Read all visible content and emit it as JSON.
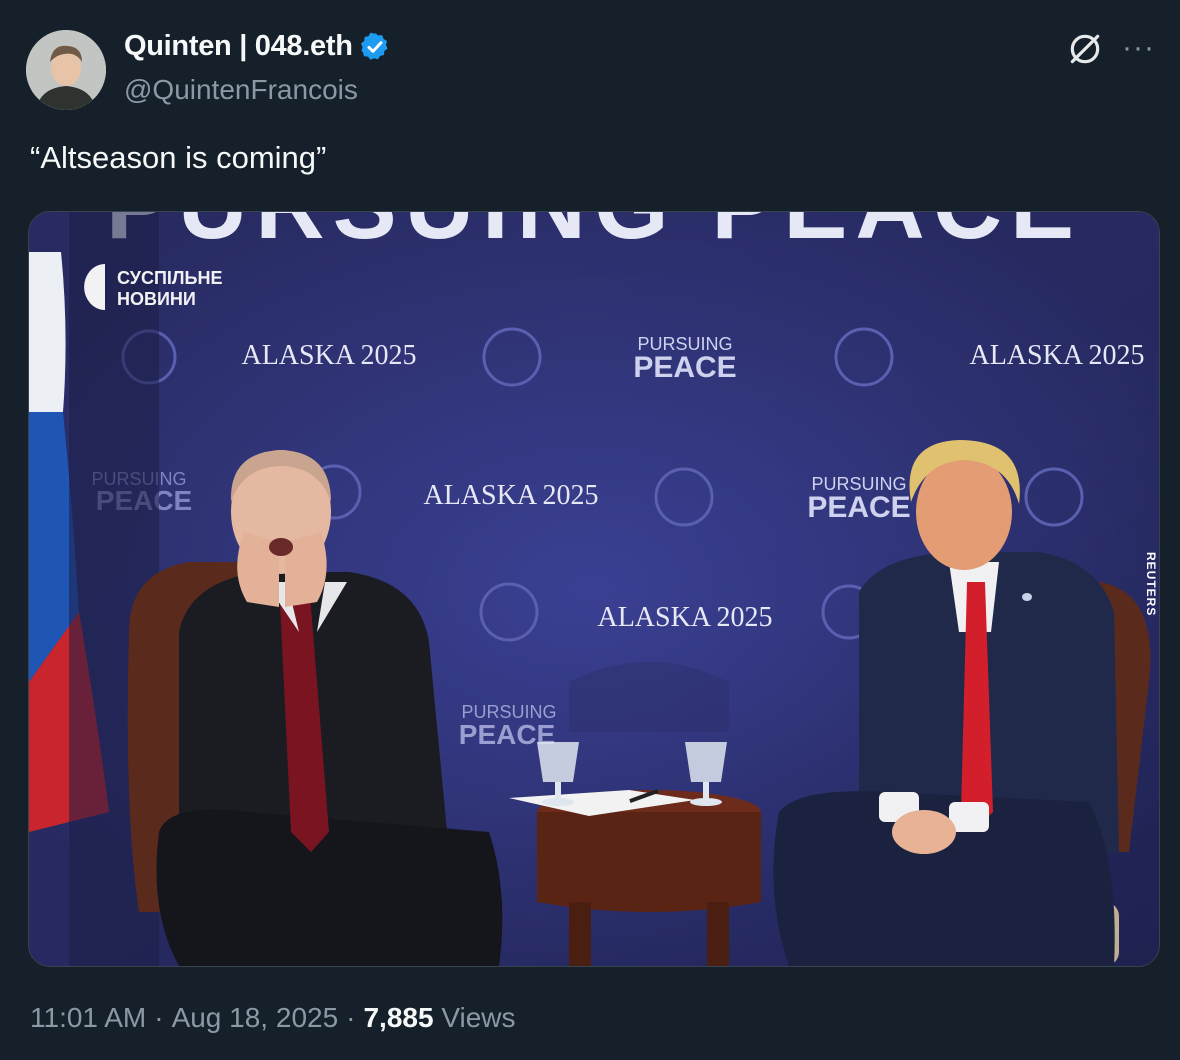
{
  "author": {
    "display_name": "Quinten | 048.eth",
    "handle": "@QuintenFrancois",
    "verified_icon": "verified-badge-icon"
  },
  "header_icons": {
    "grok": "grok-icon",
    "more": "···"
  },
  "tweet": {
    "text": "“Altseason is coming”"
  },
  "image": {
    "banner_top": "PURSUING PEACE",
    "tags": [
      "ALASKA 2025",
      "PURSUING",
      "PEACE"
    ],
    "watermark_line1": "СУСПІЛЬНЕ",
    "watermark_line2": "НОВИНИ",
    "credit": "REUTERS"
  },
  "meta": {
    "time": "11:01 AM",
    "date": "Aug 18, 2025",
    "views_count": "7,885",
    "views_label": "Views"
  },
  "colors": {
    "background": "#15202b",
    "secondary_text": "#8b98a5",
    "verified": "#1d9bf0",
    "backdrop": "#3b3f92"
  }
}
